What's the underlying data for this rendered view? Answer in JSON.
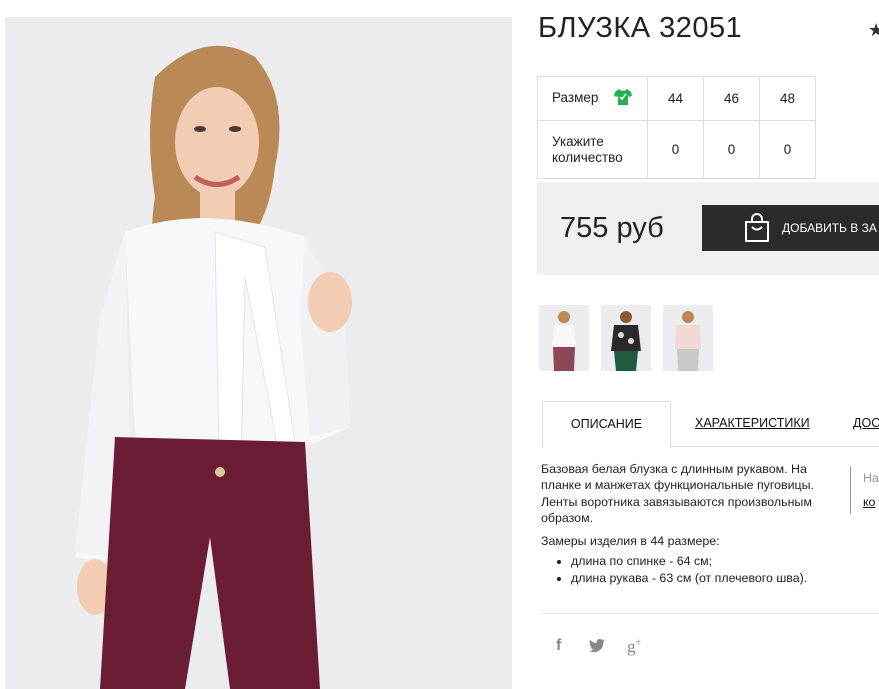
{
  "product": {
    "title": "БЛУЗКА 32051",
    "fav_icon": "star-icon"
  },
  "sizes": {
    "size_label": "Размер",
    "size_icon": "tshirt-icon",
    "size_icon_color": "#22b14c",
    "values": [
      "44",
      "46",
      "48"
    ],
    "qty_label_1": "Укажите",
    "qty_label_2": "количество",
    "quantities": [
      "0",
      "0",
      "0"
    ]
  },
  "price": {
    "amount": "755 руб",
    "add_button": "ДОБАВИТЬ В ЗА",
    "cart_icon": "shopping-bag-icon"
  },
  "tabs": [
    {
      "label": "ОПИСАНИЕ",
      "active": true
    },
    {
      "label": "ХАРАКТЕРИСТИКИ",
      "active": false
    },
    {
      "label": "ДОС",
      "active": false
    }
  ],
  "description": {
    "text": "Базовая белая блузка с длинным рукавом. На планке и манжетах функциональные пуговицы. Ленты воротника завязываются произвольным образом.",
    "measures_title": "Замеры изделия в 44 размере:",
    "measures": [
      "длина по спинке - 64 см;",
      "длина рукава - 63 см (от плечевого шва)."
    ]
  },
  "side_note": {
    "line1": "На",
    "line2": "ко"
  },
  "social": [
    "facebook-icon",
    "twitter-icon",
    "google-plus-icon"
  ],
  "colors": {
    "accent_dark": "#2b2b2b",
    "price_bg": "#f0f0f0",
    "trousers": "#6a1d33"
  }
}
